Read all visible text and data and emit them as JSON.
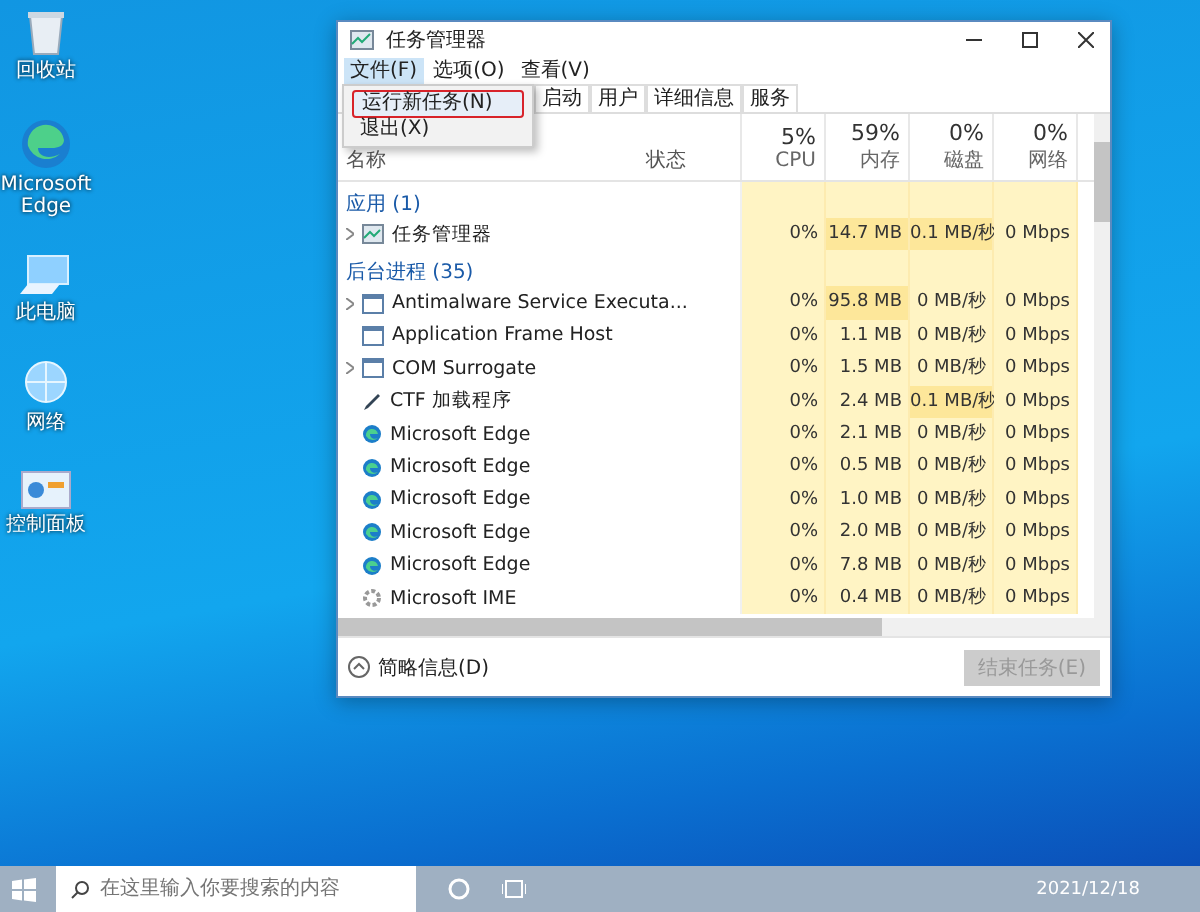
{
  "desktop_icons": [
    {
      "label": "回收站",
      "kind": "bin"
    },
    {
      "label": "Microsoft Edge",
      "kind": "edge"
    },
    {
      "label": "此电脑",
      "kind": "pc"
    },
    {
      "label": "网络",
      "kind": "net"
    },
    {
      "label": "控制面板",
      "kind": "panel"
    }
  ],
  "window": {
    "title": "任务管理器"
  },
  "menu_bar": [
    {
      "label": "文件(F)",
      "selected": true
    },
    {
      "label": "选项(O)",
      "selected": false
    },
    {
      "label": "查看(V)",
      "selected": false
    }
  ],
  "file_menu": [
    {
      "label": "运行新任务(N)",
      "highlighted": true
    },
    {
      "label": "退出(X)",
      "highlighted": false
    }
  ],
  "tabs": [
    {
      "label": "启动",
      "selected": false
    },
    {
      "label": "用户",
      "selected": false
    },
    {
      "label": "详细信息",
      "selected": false
    },
    {
      "label": "服务",
      "selected": false
    }
  ],
  "columns": [
    {
      "label": "名称"
    },
    {
      "label": "状态"
    },
    {
      "percent": "5%",
      "label": "CPU"
    },
    {
      "percent": "59%",
      "label": "内存"
    },
    {
      "percent": "0%",
      "label": "磁盘"
    },
    {
      "percent": "0%",
      "label": "网络"
    }
  ],
  "groups": [
    {
      "title": "应用 (1)",
      "rows": [
        {
          "name": "任务管理器",
          "kind": "tm",
          "expandable": true,
          "cells": [
            {
              "text": "0%",
              "hot": false
            },
            {
              "text": "14.7 MB",
              "hot": true
            },
            {
              "text": "0.1 MB/秒",
              "hot": true
            },
            {
              "text": "0 Mbps",
              "hot": false
            }
          ]
        }
      ]
    },
    {
      "title": "后台进程 (35)",
      "rows": [
        {
          "name": "Antimalware Service Executa...",
          "kind": "svc",
          "expandable": true,
          "cells": [
            {
              "text": "0%",
              "hot": false
            },
            {
              "text": "95.8 MB",
              "hot": true
            },
            {
              "text": "0 MB/秒",
              "hot": false
            },
            {
              "text": "0 Mbps",
              "hot": false
            }
          ]
        },
        {
          "name": "Application Frame Host",
          "kind": "svc",
          "expandable": false,
          "cells": [
            {
              "text": "0%",
              "hot": false
            },
            {
              "text": "1.1 MB",
              "hot": false
            },
            {
              "text": "0 MB/秒",
              "hot": false
            },
            {
              "text": "0 Mbps",
              "hot": false
            }
          ]
        },
        {
          "name": "COM Surrogate",
          "kind": "svc",
          "expandable": true,
          "cells": [
            {
              "text": "0%",
              "hot": false
            },
            {
              "text": "1.5 MB",
              "hot": false
            },
            {
              "text": "0 MB/秒",
              "hot": false
            },
            {
              "text": "0 Mbps",
              "hot": false
            }
          ]
        },
        {
          "name": "CTF 加载程序",
          "kind": "pen",
          "expandable": false,
          "cells": [
            {
              "text": "0%",
              "hot": false
            },
            {
              "text": "2.4 MB",
              "hot": false
            },
            {
              "text": "0.1 MB/秒",
              "hot": true
            },
            {
              "text": "0 Mbps",
              "hot": false
            }
          ]
        },
        {
          "name": "Microsoft Edge",
          "kind": "edge",
          "expandable": false,
          "cells": [
            {
              "text": "0%",
              "hot": false
            },
            {
              "text": "2.1 MB",
              "hot": false
            },
            {
              "text": "0 MB/秒",
              "hot": false
            },
            {
              "text": "0 Mbps",
              "hot": false
            }
          ]
        },
        {
          "name": "Microsoft Edge",
          "kind": "edge",
          "expandable": false,
          "cells": [
            {
              "text": "0%",
              "hot": false
            },
            {
              "text": "0.5 MB",
              "hot": false
            },
            {
              "text": "0 MB/秒",
              "hot": false
            },
            {
              "text": "0 Mbps",
              "hot": false
            }
          ]
        },
        {
          "name": "Microsoft Edge",
          "kind": "edge",
          "expandable": false,
          "cells": [
            {
              "text": "0%",
              "hot": false
            },
            {
              "text": "1.0 MB",
              "hot": false
            },
            {
              "text": "0 MB/秒",
              "hot": false
            },
            {
              "text": "0 Mbps",
              "hot": false
            }
          ]
        },
        {
          "name": "Microsoft Edge",
          "kind": "edge",
          "expandable": false,
          "cells": [
            {
              "text": "0%",
              "hot": false
            },
            {
              "text": "2.0 MB",
              "hot": false
            },
            {
              "text": "0 MB/秒",
              "hot": false
            },
            {
              "text": "0 Mbps",
              "hot": false
            }
          ]
        },
        {
          "name": "Microsoft Edge",
          "kind": "edge",
          "expandable": false,
          "cells": [
            {
              "text": "0%",
              "hot": false
            },
            {
              "text": "7.8 MB",
              "hot": false
            },
            {
              "text": "0 MB/秒",
              "hot": false
            },
            {
              "text": "0 Mbps",
              "hot": false
            }
          ]
        },
        {
          "name": "Microsoft IME",
          "kind": "gear",
          "expandable": false,
          "cells": [
            {
              "text": "0%",
              "hot": false
            },
            {
              "text": "0.4 MB",
              "hot": false
            },
            {
              "text": "0 MB/秒",
              "hot": false
            },
            {
              "text": "0 Mbps",
              "hot": false
            }
          ]
        }
      ]
    }
  ],
  "footer": {
    "fewer_details": "简略信息(D)",
    "end_task": {
      "label": "结束任务(E)",
      "disabled": true
    }
  },
  "taskbar": {
    "search_placeholder": "在这里输入你要搜索的内容",
    "date": "2021/12/18"
  }
}
